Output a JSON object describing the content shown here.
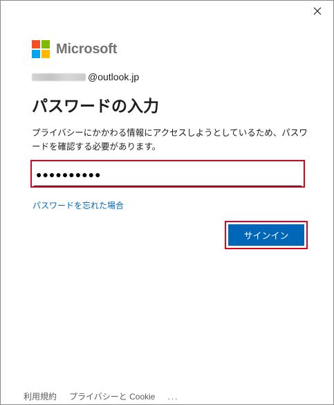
{
  "window": {
    "close_icon": "close-icon"
  },
  "brand": {
    "name": "Microsoft",
    "logo_colors": [
      "#f25022",
      "#7fba00",
      "#00a4ef",
      "#ffb900"
    ]
  },
  "account": {
    "email_suffix": "@outlook.jp"
  },
  "page": {
    "title": "パスワードの入力",
    "description": "プライバシーにかかわる情報にアクセスしようとしているため、パスワードを確認する必要があります。"
  },
  "password": {
    "value": "●●●●●●●●●●"
  },
  "links": {
    "forgot_password": "パスワードを忘れた場合"
  },
  "actions": {
    "sign_in": "サインイン"
  },
  "footer": {
    "terms": "利用規約",
    "privacy": "プライバシーと Cookie",
    "more": "..."
  },
  "colors": {
    "accent": "#0067b8",
    "highlight": "#e3001b"
  }
}
